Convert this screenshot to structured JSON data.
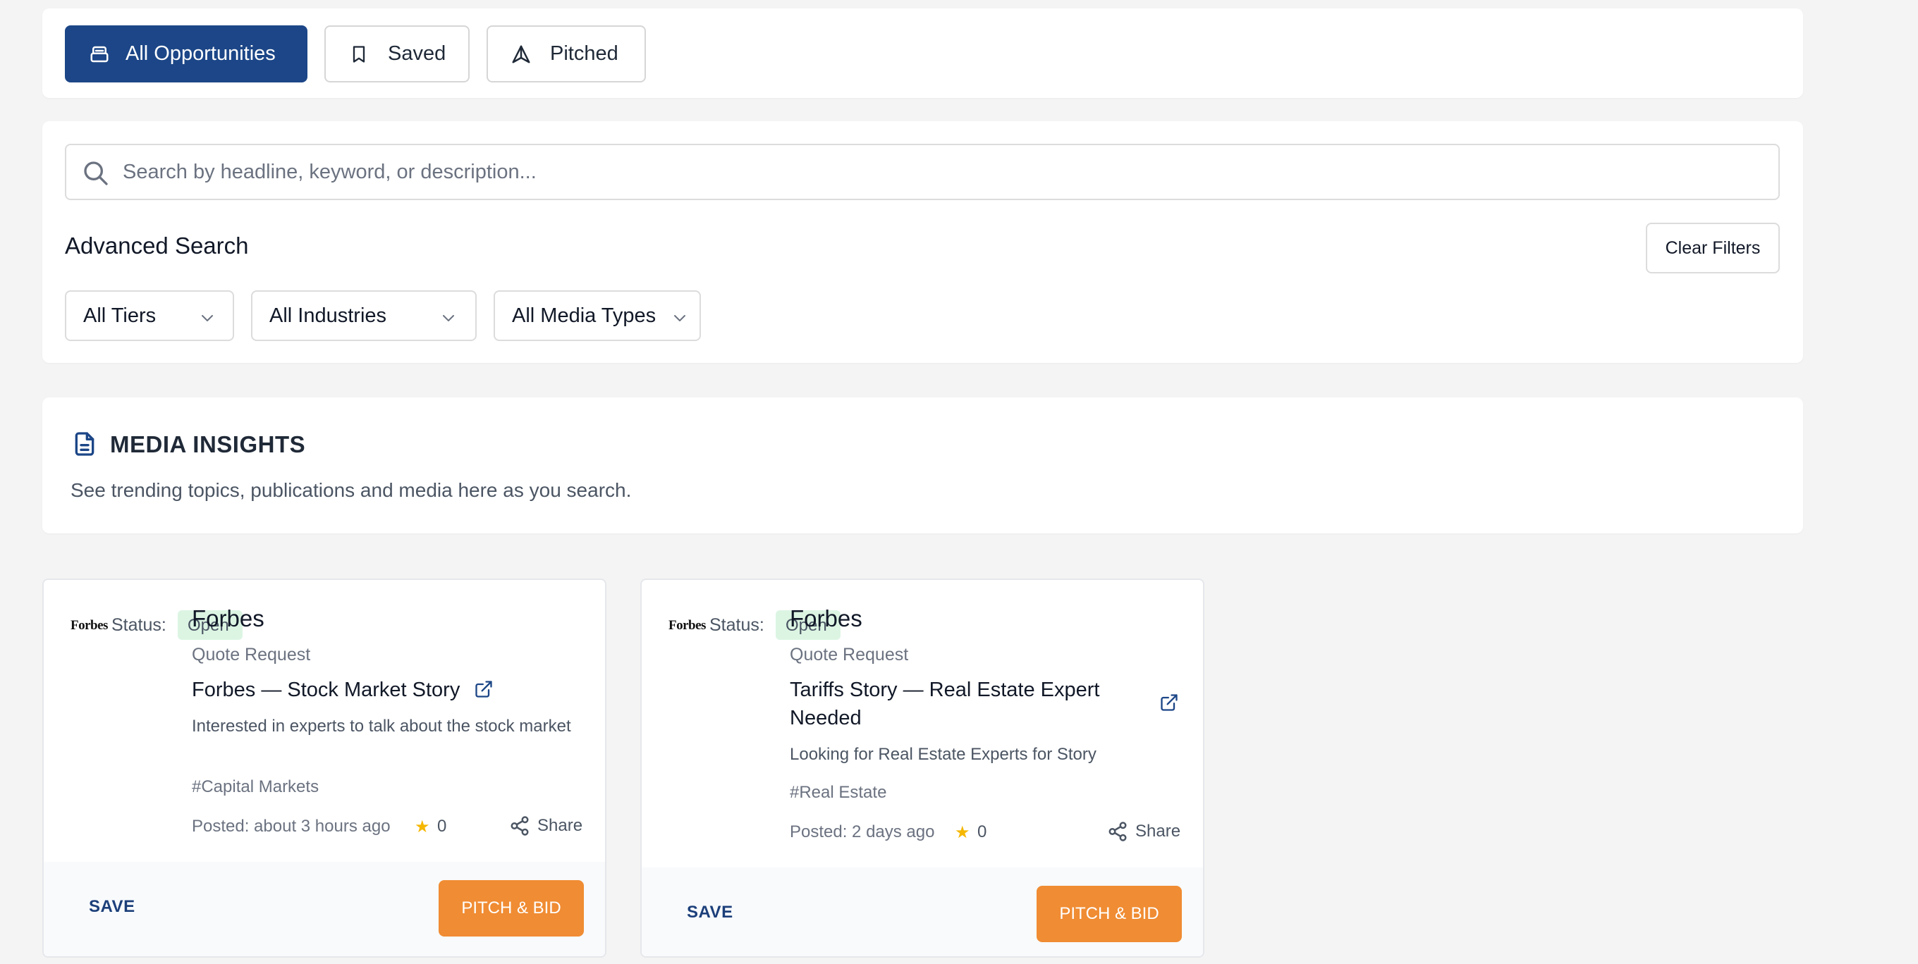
{
  "tabs": [
    {
      "label": "All Opportunities",
      "icon": "inbox-icon",
      "active": true
    },
    {
      "label": "Saved",
      "icon": "bookmark-icon",
      "active": false
    },
    {
      "label": "Pitched",
      "icon": "send-icon",
      "active": false
    }
  ],
  "search": {
    "placeholder": "Search by headline, keyword, or description...",
    "value": ""
  },
  "advanced": {
    "title": "Advanced Search",
    "clear_label": "Clear Filters",
    "filters": [
      "All Tiers",
      "All Industries",
      "All Media Types"
    ]
  },
  "insights": {
    "title": "MEDIA INSIGHTS",
    "subtitle": "See trending topics, publications and media here as you search."
  },
  "cards": [
    {
      "logo_text": "Forbes",
      "status_label": "Status:",
      "status": "Open",
      "publication": "Forbes",
      "type": "Quote Request",
      "headline": "Forbes — Stock Market Story",
      "description": "Interested in experts to talk about the stock market",
      "tag": "#Capital Markets",
      "posted": "Posted: about 3 hours ago",
      "votes": "0",
      "share_label": "Share",
      "save_label": "SAVE",
      "pitch_label": "PITCH & BID"
    },
    {
      "logo_text": "Forbes",
      "status_label": "Status:",
      "status": "Open",
      "publication": "Forbes",
      "type": "Quote Request",
      "headline_line1": "Tariffs Story — Real Estate Expert",
      "headline_line2": "Needed",
      "description": "Looking for Real Estate Experts for Story",
      "tag": "#Real Estate",
      "posted": "Posted: 2 days ago",
      "votes": "0",
      "share_label": "Share",
      "save_label": "SAVE",
      "pitch_label": "PITCH & BID"
    }
  ],
  "colors": {
    "primary": "#1c4687",
    "accent": "#f08c33",
    "status_open_bg": "#dcf5e3",
    "star": "#f5b700"
  }
}
